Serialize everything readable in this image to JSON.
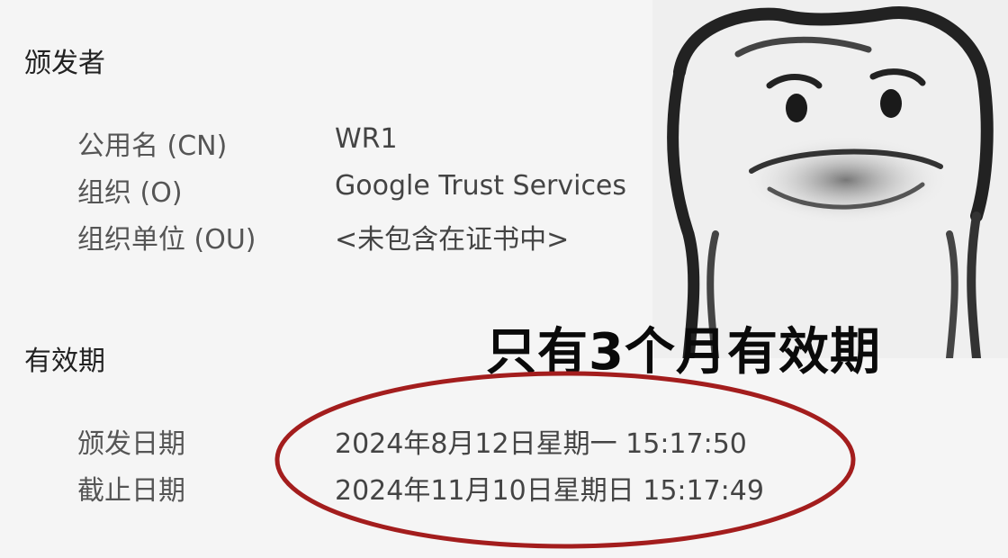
{
  "issuer": {
    "title": "颁发者",
    "rows": [
      {
        "label": "公用名 (CN)",
        "value": "WR1"
      },
      {
        "label": "组织 (O)",
        "value": "Google Trust Services"
      },
      {
        "label": "组织单位 (OU)",
        "value": "<未包含在证书中>"
      }
    ]
  },
  "validity": {
    "title": "有效期",
    "rows": [
      {
        "label": "颁发日期",
        "value": "2024年8月12日星期一 15:17:50"
      },
      {
        "label": "截止日期",
        "value": "2024年11月10日星期日 15:17:49"
      }
    ]
  },
  "overlay": {
    "caption": "只有3个月有效期",
    "ellipse_color": "#a31d1d"
  }
}
